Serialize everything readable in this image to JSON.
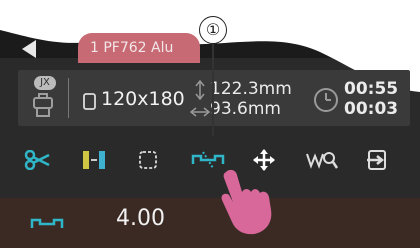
{
  "header": {
    "tab_label": "1 PF762 Alu",
    "callout_number": "①"
  },
  "info": {
    "badge": "JX",
    "paper_size": "120x180",
    "dim_1": "122.3mm",
    "dim_2": "93.6mm",
    "time_1": "00:55",
    "time_2": "00:03"
  },
  "toolbar": {
    "tools": [
      "cut",
      "align",
      "frame",
      "cut-jumper",
      "move",
      "weld-search",
      "import"
    ],
    "active": "cut-jumper"
  },
  "footer": {
    "value": "4.00"
  },
  "colors": {
    "accent": "#2fb6c8",
    "panel": "#2a2a2a",
    "tab": "#c76a74",
    "hand": "#d8679a"
  }
}
